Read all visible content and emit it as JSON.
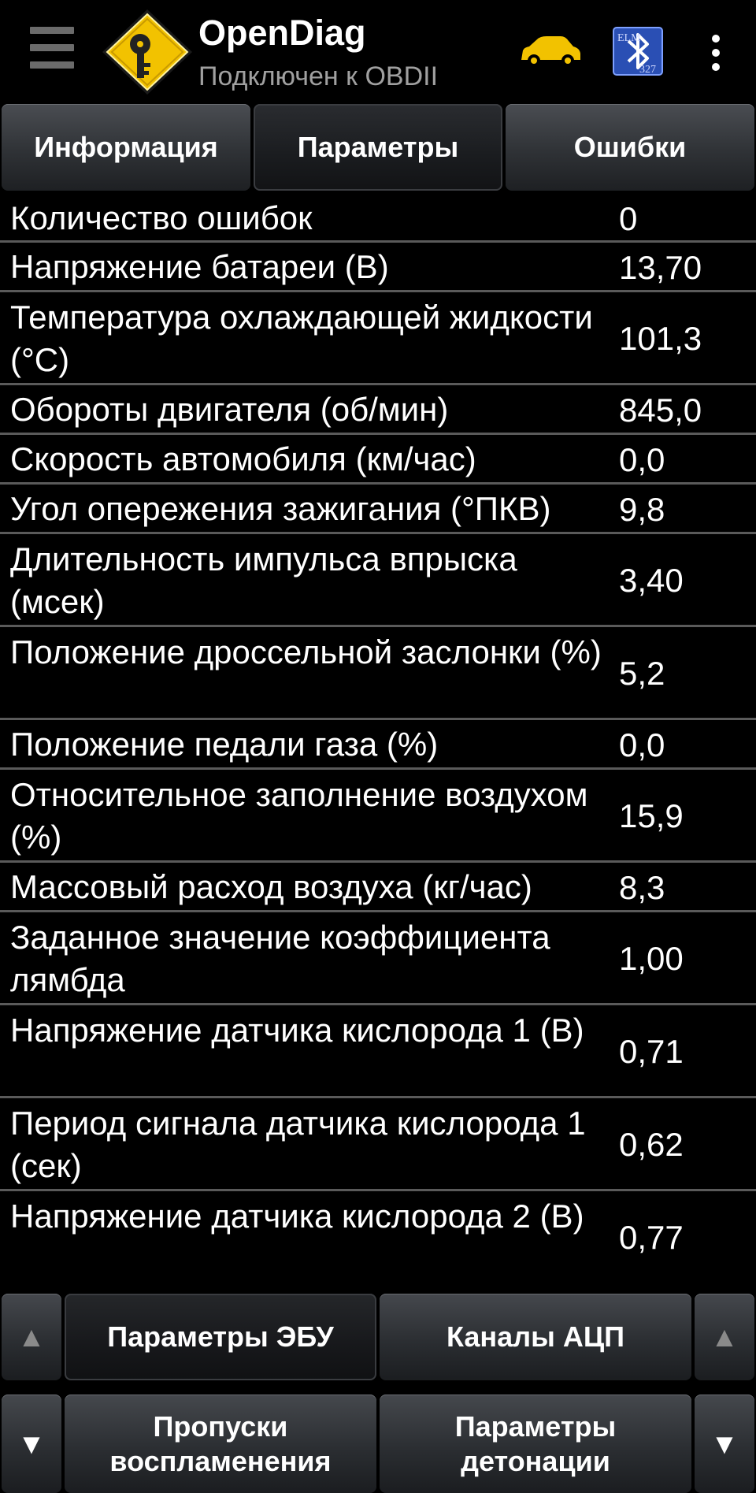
{
  "app": {
    "title": "OpenDiag",
    "subtitle": "Подключен к OBDII"
  },
  "icons": {
    "menu": "menu-icon",
    "logo": "opendiag-logo",
    "car": "car-icon",
    "bluetooth": "elm327-bluetooth-icon",
    "overflow": "overflow-menu-icon",
    "car_color": "#f2c200",
    "logo_color": "#f2c200"
  },
  "tabs": [
    {
      "label": "Информация",
      "active": false
    },
    {
      "label": "Параметры",
      "active": true
    },
    {
      "label": "Ошибки",
      "active": false
    }
  ],
  "parameters": [
    {
      "name": "Количество ошибок",
      "value": "0"
    },
    {
      "name": "Напряжение батареи (В)",
      "value": "13,70"
    },
    {
      "name": "Температура охлаждающей жидкости (°С)",
      "value": "101,3"
    },
    {
      "name": "Обороты двигателя (об/мин)",
      "value": "845,0"
    },
    {
      "name": "Скорость автомобиля (км/час)",
      "value": "0,0"
    },
    {
      "name": "Угол опережения зажигания (°ПКВ)",
      "value": "9,8"
    },
    {
      "name": "Длительность импульса впрыска (мсек)",
      "value": "3,40"
    },
    {
      "name": "Положение дроссельной заслонки (%)",
      "value": "5,2"
    },
    {
      "name": "Положение педали газа (%)",
      "value": "0,0"
    },
    {
      "name": "Относительное заполнение воздухом (%)",
      "value": "15,9"
    },
    {
      "name": "Массовый расход воздуха (кг/час)",
      "value": "8,3"
    },
    {
      "name": "Заданное значение коэффициента лямбда",
      "value": "1,00"
    },
    {
      "name": "Напряжение датчика кислорода 1 (В)",
      "value": "0,71"
    },
    {
      "name": "Период сигнала датчика кислорода 1 (сек)",
      "value": "0,62"
    },
    {
      "name": "Напряжение датчика кислорода 2 (В)",
      "value": "0,77"
    }
  ],
  "bottom_nav": {
    "ecu_params": "Параметры ЭБУ",
    "adc_channels": "Каналы АЦП",
    "misfires": "Пропуски воспламенения",
    "knock_params": "Параметры детонации",
    "up_arrow": "▲",
    "down_arrow": "▼"
  }
}
